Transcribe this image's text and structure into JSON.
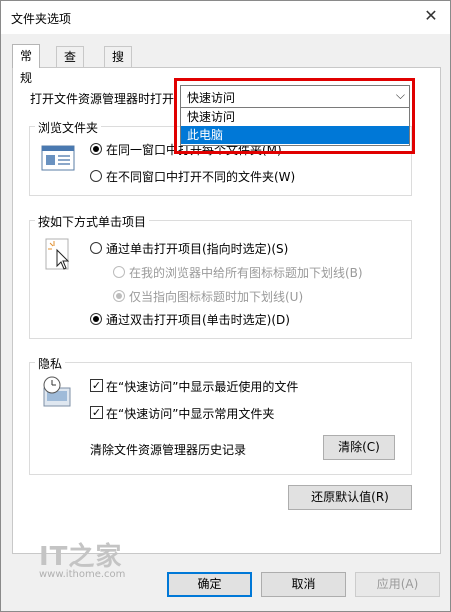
{
  "window": {
    "title": "文件夹选项",
    "close_glyph": "✕"
  },
  "tabs": [
    {
      "label": "常规",
      "active": true
    },
    {
      "label": "查看",
      "active": false
    },
    {
      "label": "搜索",
      "active": false
    }
  ],
  "open_explorer": {
    "label": "打开文件资源管理器时打开:",
    "value": "快速访问",
    "options": [
      "快速访问",
      "此电脑"
    ],
    "highlighted_option": "此电脑"
  },
  "browse": {
    "title": "浏览文件夹",
    "same_window": "在同一窗口中打开每个文件夹(M)",
    "new_window": "在不同窗口中打开不同的文件夹(W)",
    "selected": "same_window"
  },
  "click": {
    "title": "按如下方式单击项目",
    "single": "通过单击打开项目(指向时选定)(S)",
    "underline_all": "在我的浏览器中给所有图标标题加下划线(B)",
    "underline_hover": "仅当指向图标标题时加下划线(U)",
    "double": "通过双击打开项目(单击时选定)(D)",
    "selected": "double"
  },
  "privacy": {
    "title": "隐私",
    "recent_files": "在“快速访问”中显示最近使用的文件",
    "frequent_folders": "在“快速访问”中显示常用文件夹",
    "clear_label": "清除文件资源管理器历史记录",
    "clear_button": "清除(C)",
    "recent_checked": true,
    "frequent_checked": true,
    "check_glyph": "✓"
  },
  "restore_button": "还原默认值(R)",
  "buttons": {
    "ok": "确定",
    "cancel": "取消",
    "apply": "应用(A)"
  },
  "watermark": {
    "logo": "IT之家",
    "url": "www.ithome.com"
  },
  "colors": {
    "highlight": "#0078d7",
    "annotation": "#e00000"
  }
}
